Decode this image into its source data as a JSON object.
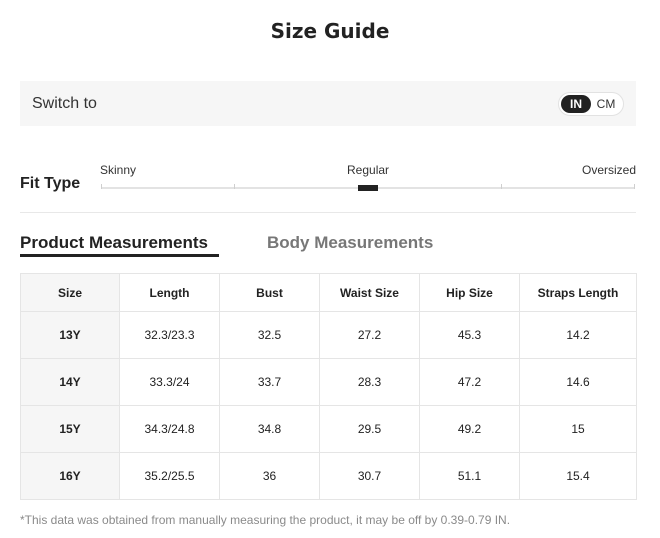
{
  "page": {
    "title": "Size Guide"
  },
  "switch": {
    "label": "Switch to",
    "units": [
      "IN",
      "CM"
    ],
    "selected": "IN"
  },
  "fit": {
    "label": "Fit Type",
    "options": [
      "Skinny",
      "Regular",
      "Oversized"
    ],
    "selected": "Regular"
  },
  "tabs": [
    {
      "label": "Product Measurements",
      "active": true
    },
    {
      "label": "Body Measurements",
      "active": false
    }
  ],
  "table": {
    "headers": [
      "Size",
      "Length",
      "Bust",
      "Waist Size",
      "Hip Size",
      "Straps Length"
    ],
    "rows": [
      [
        "13Y",
        "32.3/23.3",
        "32.5",
        "27.2",
        "45.3",
        "14.2"
      ],
      [
        "14Y",
        "33.3/24",
        "33.7",
        "28.3",
        "47.2",
        "14.6"
      ],
      [
        "15Y",
        "34.3/24.8",
        "34.8",
        "29.5",
        "49.2",
        "15"
      ],
      [
        "16Y",
        "35.2/25.5",
        "36",
        "30.7",
        "51.1",
        "15.4"
      ]
    ]
  },
  "note": "*This data was obtained from manually measuring the product, it may be off by 0.39-0.79 IN.",
  "colors": {
    "accent": "#222222",
    "panel": "#f6f6f6",
    "muted": "#8a8a8a"
  }
}
